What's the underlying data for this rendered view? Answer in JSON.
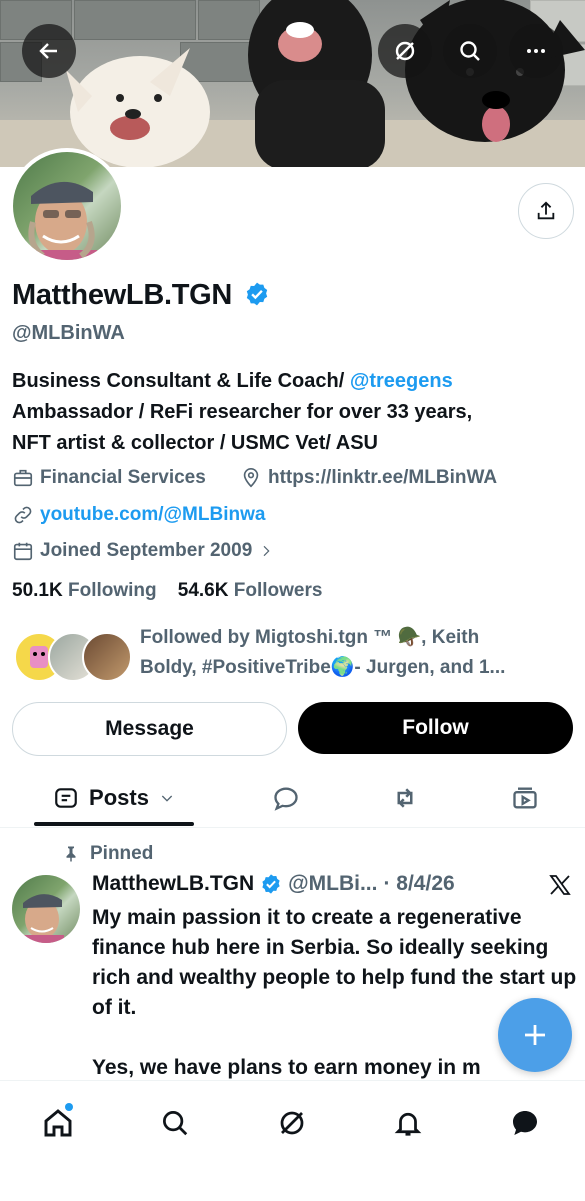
{
  "profile": {
    "name": "MatthewLB.TGN",
    "handle": "@MLBinWA",
    "bio_line1_prefix": "Business Consultant & Life Coach/ ",
    "bio_mention": "@treegens",
    "bio_line2": "Ambassador / ReFi researcher for over 33 years,",
    "bio_line3": "NFT artist & collector / USMC Vet/ ASU",
    "category": "Financial Services",
    "website": "https://linktr.ee/MLBinWA",
    "youtube": "youtube.com/@MLBinwa",
    "joined": "Joined September 2009",
    "following_count": "50.1K",
    "following_label": "Following",
    "followers_count": "54.6K",
    "followers_label": "Followers",
    "followed_by_line1": "Followed by Migtoshi.tgn ™ 🪖, Keith",
    "followed_by_line2": "Boldy, #PositiveTribe🌍- Jurgen, and 1..."
  },
  "actions": {
    "message_label": "Message",
    "follow_label": "Follow"
  },
  "tabs": {
    "posts_label": "Posts"
  },
  "post": {
    "pinned_label": "Pinned",
    "author_name": "MatthewLB.TGN",
    "author_handle": "@MLBi...",
    "date": "· 8/4/26",
    "text": "My main passion it to create a regenerative finance hub here in Serbia.  So ideally seeking rich and wealthy people to help fund the start up of it.\n\nYes, we have plans to earn money in m"
  },
  "colors": {
    "accent": "#1d9bf0",
    "verified": "#1d9bf0",
    "fab": "#4c9fe8",
    "text": "#0f1419",
    "muted": "#536471"
  },
  "icons": [
    "back-arrow-icon",
    "grok-icon",
    "search-icon",
    "more-icon",
    "share-icon",
    "verified-badge-icon",
    "briefcase-icon",
    "location-icon",
    "link-icon",
    "calendar-icon",
    "chevron-right-icon",
    "posts-icon",
    "chevron-down-icon",
    "replies-icon",
    "retweet-icon",
    "media-icon",
    "pin-icon",
    "x-logo-icon",
    "plus-icon",
    "home-icon",
    "grok-icon",
    "bell-icon",
    "messages-icon"
  ]
}
